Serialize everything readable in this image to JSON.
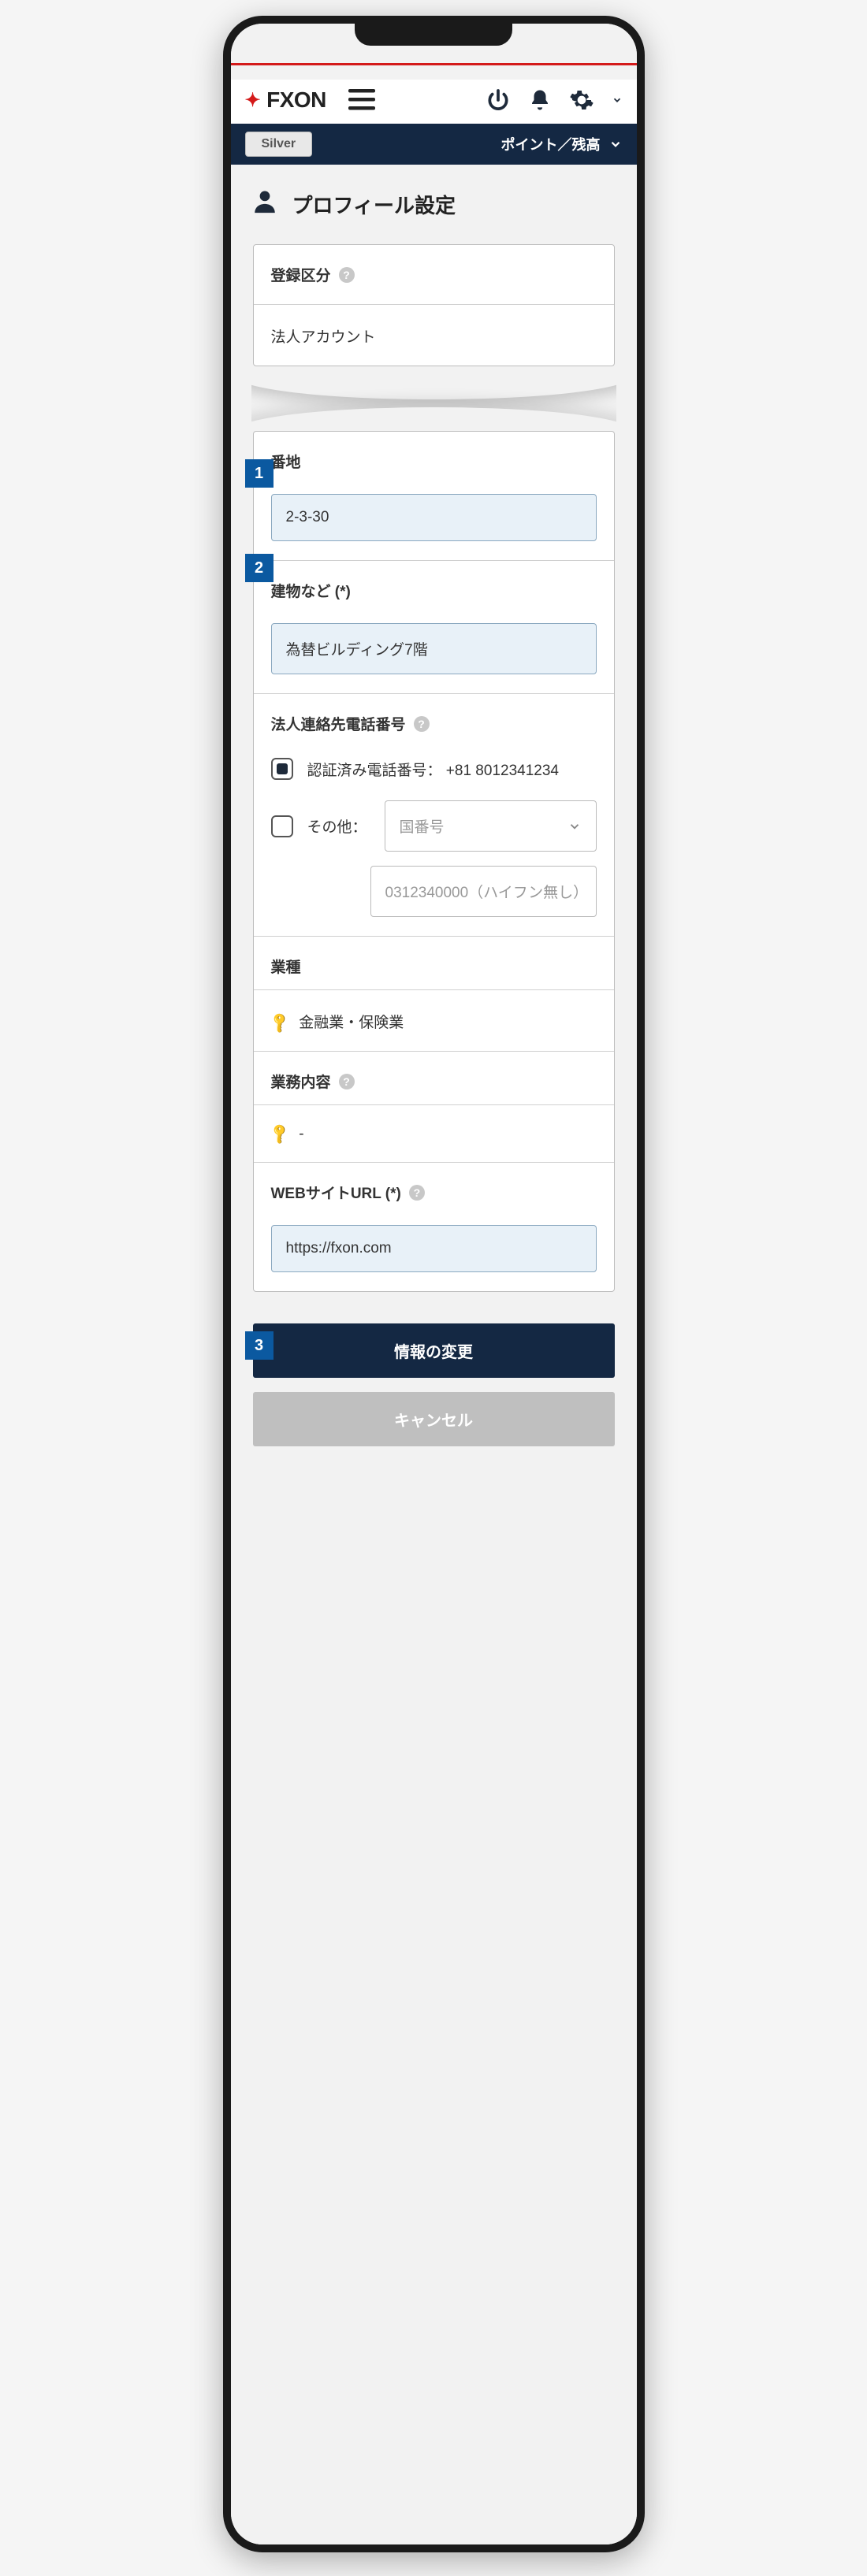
{
  "header": {
    "logo_text": "FXON",
    "tier_badge": "Silver",
    "balance_label": "ポイント／残高"
  },
  "page": {
    "title": "プロフィール設定"
  },
  "registration": {
    "label": "登録区分",
    "value": "法人アカウント"
  },
  "address": {
    "street_label": "番地",
    "street_value": "2-3-30",
    "building_label": "建物など (*)",
    "building_value": "為替ビルディング7階"
  },
  "phone": {
    "label": "法人連絡先電話番号",
    "verified_label": "認証済み電話番号：",
    "verified_value": "+81 8012341234",
    "other_label": "その他：",
    "country_placeholder": "国番号",
    "number_placeholder": "0312340000（ハイフン無し）"
  },
  "industry": {
    "label": "業種",
    "value": "金融業・保険業"
  },
  "business": {
    "label": "業務内容",
    "value": "-"
  },
  "website": {
    "label": "WEBサイトURL (*)",
    "value": "https://fxon.com"
  },
  "buttons": {
    "submit": "情報の変更",
    "cancel": "キャンセル"
  },
  "badges": {
    "b1": "1",
    "b2": "2",
    "b3": "3"
  }
}
